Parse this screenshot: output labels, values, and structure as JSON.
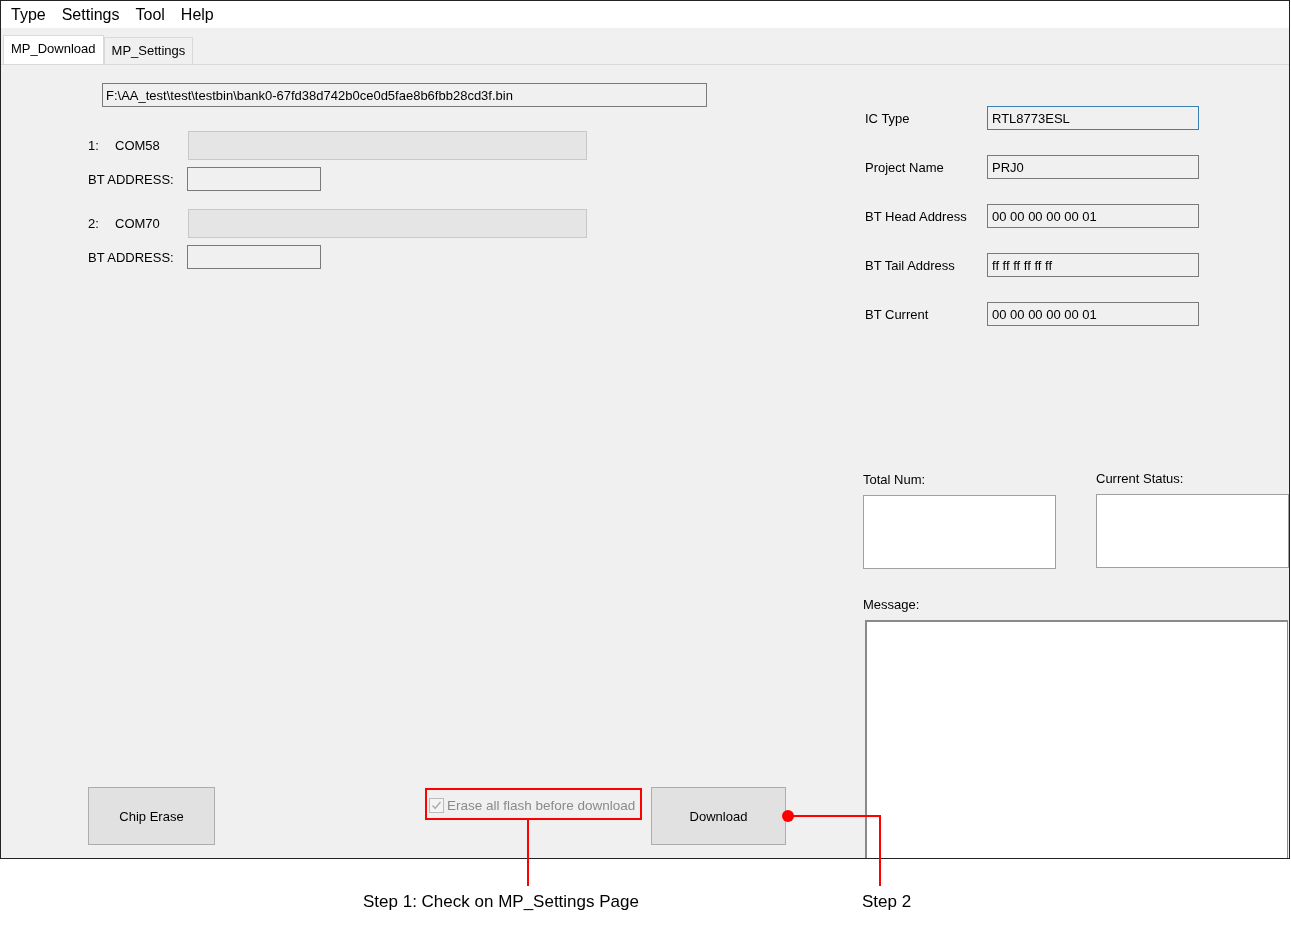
{
  "menu": [
    {
      "label": "Type"
    },
    {
      "label": "Settings"
    },
    {
      "label": "Tool"
    },
    {
      "label": "Help"
    }
  ],
  "tabs": [
    {
      "label": "MP_Download",
      "selected": true
    },
    {
      "label": "MP_Settings",
      "selected": false
    }
  ],
  "file_path": "F:\\AA_test\\test\\testbin\\bank0-67fd38d742b0ce0d5fae8b6fbb28cd3f.bin",
  "ports": [
    {
      "index": "1:",
      "name": "COM58",
      "level": 0,
      "bt_address_label": "BT ADDRESS:"
    },
    {
      "index": "2:",
      "name": "COM70",
      "level": 0,
      "bt_address_label": "BT ADDRESS:"
    }
  ],
  "device_fields": [
    {
      "label": "IC Type",
      "value": "RTL8773ESL",
      "focused": true
    },
    {
      "label": "Project Name",
      "value": "PRJ0",
      "focused": false
    },
    {
      "label": "BT Head Address",
      "value": "00 00 00 00 00 01",
      "focused": false
    },
    {
      "label": "BT Tail Address",
      "value": "ff ff ff ff ff ff",
      "focused": false
    },
    {
      "label": "BT Current",
      "value": "00 00 00 00 00 01",
      "focused": false
    }
  ],
  "counters": [
    {
      "label": "Total Num:"
    },
    {
      "label": "Current Status:"
    }
  ],
  "message": {
    "label": "Message:"
  },
  "chip_erase_button": "Chip Erase",
  "erase_checkbox": {
    "label": "Erase all flash before download",
    "checked": true,
    "disabled": true
  },
  "download_button": "Download",
  "annotations": [
    {
      "text": "Step 1: Check on MP_Settings Page"
    },
    {
      "text": "Step 2"
    }
  ]
}
